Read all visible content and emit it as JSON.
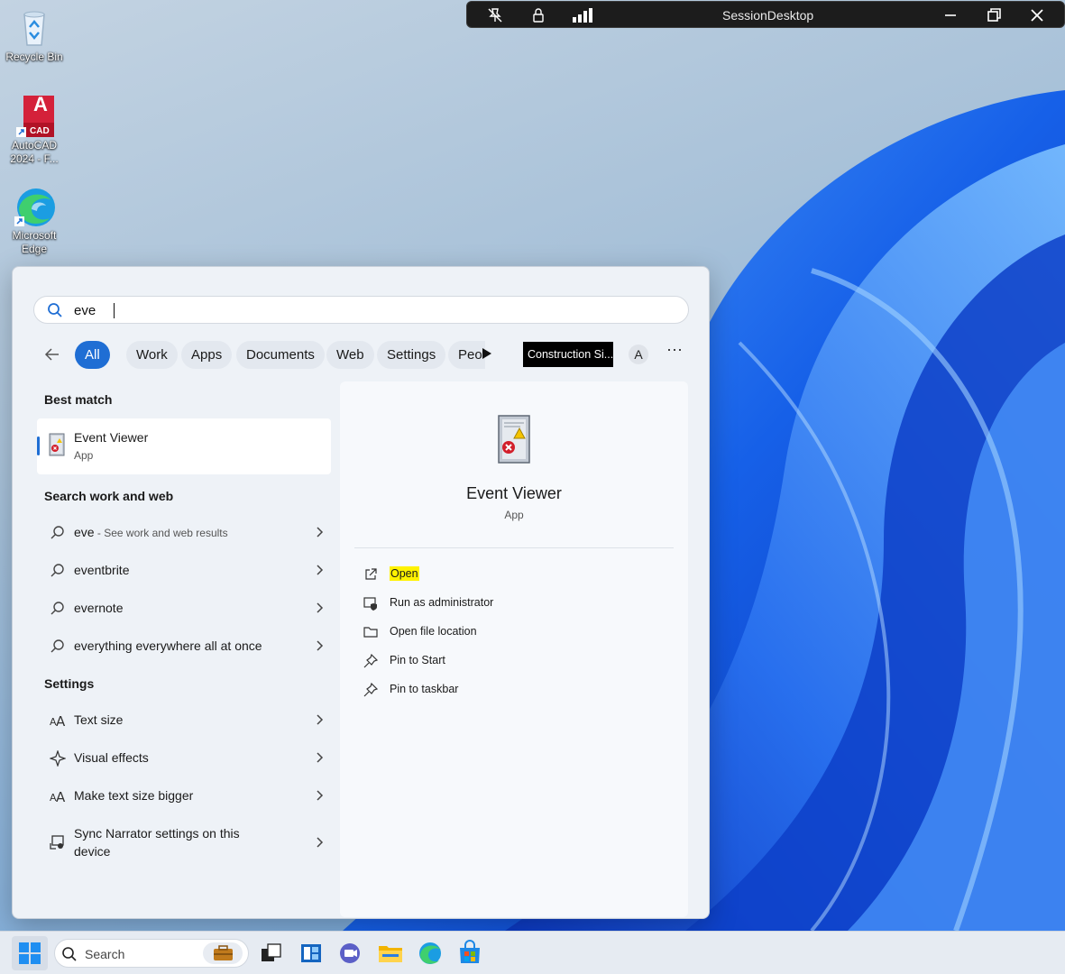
{
  "desktop": {
    "icons": [
      {
        "label": "Recycle Bin",
        "icon": "recycle-bin-icon"
      },
      {
        "label": "AutoCAD 2024 - F...",
        "icon": "autocad-icon",
        "badge": "A",
        "badge_sub": "CAD"
      },
      {
        "label": "Microsoft Edge",
        "icon": "edge-icon"
      }
    ]
  },
  "session_bar": {
    "title": "SessionDesktop",
    "icons": [
      "unpin-icon",
      "lock-icon",
      "signal-icon",
      "minimize-icon",
      "restore-icon",
      "close-icon"
    ]
  },
  "search": {
    "query": "eve",
    "placeholder": ""
  },
  "filters": {
    "chips": [
      "All",
      "Work",
      "Apps",
      "Documents",
      "Web",
      "Settings",
      "Peo"
    ],
    "active": "All",
    "org_label": "Construction Si...",
    "avatar_letter": "A",
    "more_label": "···"
  },
  "results": {
    "best_match_title": "Best match",
    "best_match": {
      "name": "Event Viewer",
      "type": "App"
    },
    "search_web_title": "Search work and web",
    "web_items": [
      {
        "text": "eve",
        "hint": " - See work and web results"
      },
      {
        "text": "eventbrite",
        "hint": ""
      },
      {
        "text": "evernote",
        "hint": ""
      },
      {
        "text": "everything everywhere all at once",
        "hint": ""
      }
    ],
    "settings_title": "Settings",
    "settings_items": [
      {
        "text": "Text size",
        "icon": "text-size-icon"
      },
      {
        "text": "Visual effects",
        "icon": "visual-effects-icon"
      },
      {
        "text": "Make text size bigger",
        "icon": "text-size-icon"
      },
      {
        "text": "Sync Narrator settings on this device",
        "icon": "narrator-sync-icon"
      }
    ]
  },
  "preview": {
    "name": "Event Viewer",
    "type": "App",
    "actions": [
      {
        "label": "Open",
        "icon": "open-external-icon",
        "highlighted": true
      },
      {
        "label": "Run as administrator",
        "icon": "shield-admin-icon",
        "highlighted": false
      },
      {
        "label": "Open file location",
        "icon": "folder-icon",
        "highlighted": false
      },
      {
        "label": "Pin to Start",
        "icon": "pin-icon",
        "highlighted": false
      },
      {
        "label": "Pin to taskbar",
        "icon": "pin-icon",
        "highlighted": false
      }
    ]
  },
  "taskbar": {
    "search_label": "Search",
    "apps": [
      "task-view-icon",
      "widgets-icon",
      "teams-icon",
      "file-explorer-icon",
      "edge-icon",
      "store-icon"
    ]
  }
}
